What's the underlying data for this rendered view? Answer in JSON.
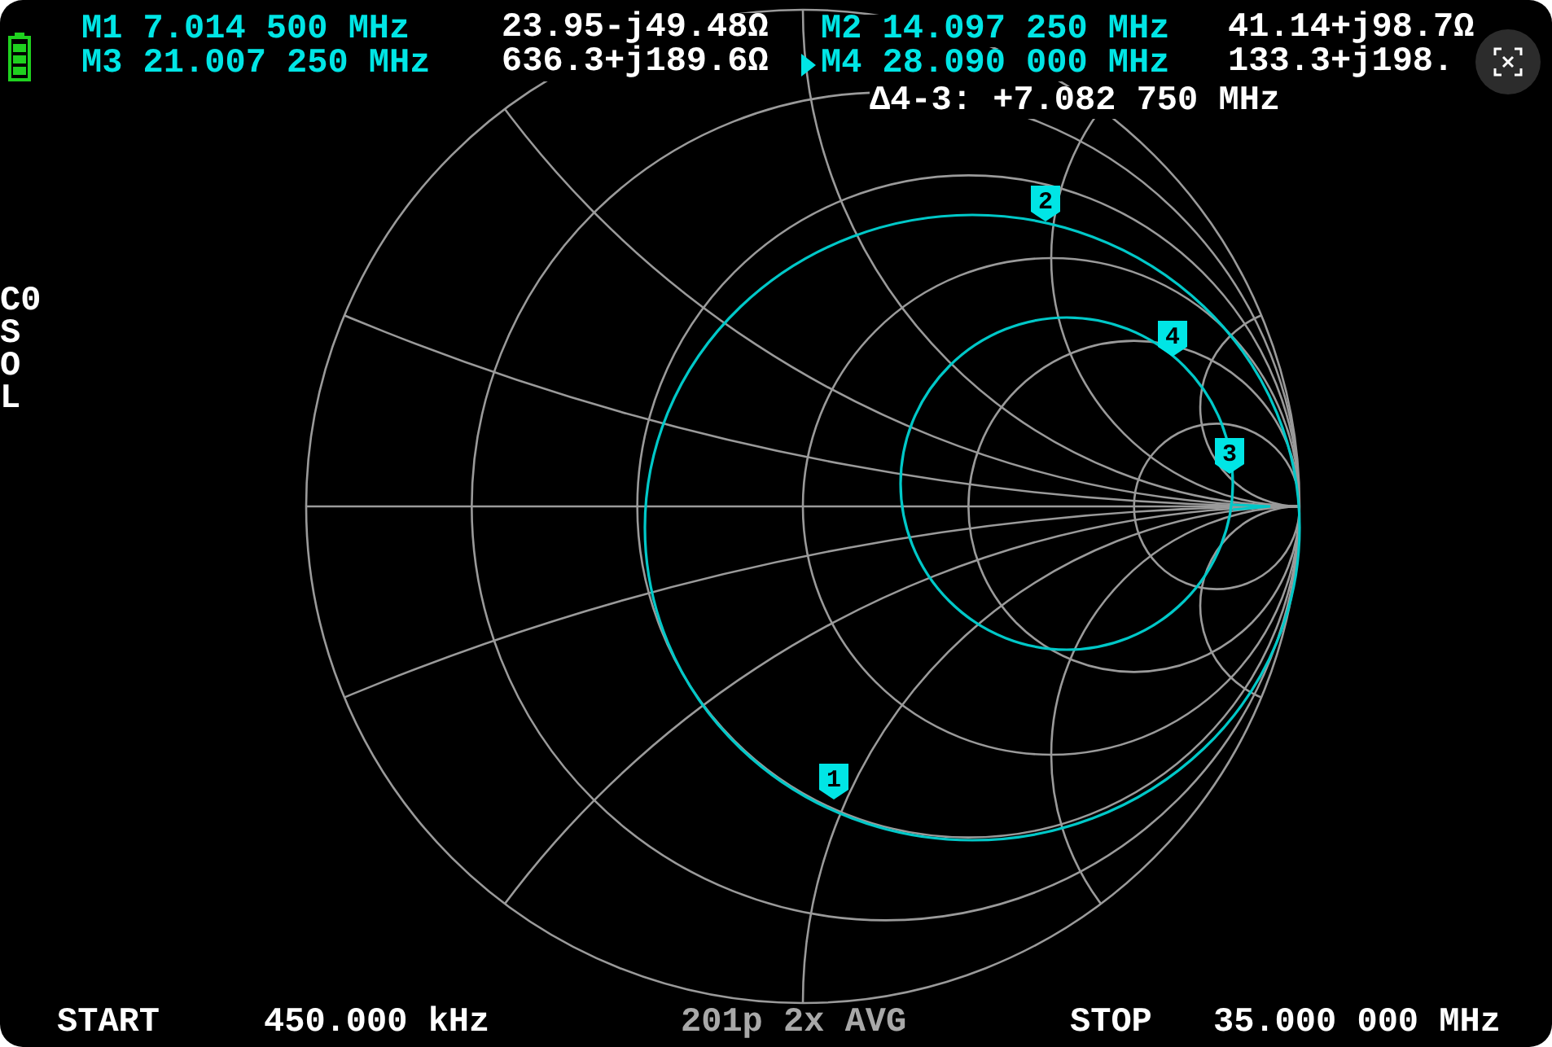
{
  "markers": [
    {
      "label": "M1",
      "frequency": "7.014 500 MHz",
      "impedance": "23.95-j49.48Ω",
      "selected": false
    },
    {
      "label": "M2",
      "frequency": "14.097 250 MHz",
      "impedance": "41.14+j98.7Ω",
      "selected": false
    },
    {
      "label": "M3",
      "frequency": "21.007 250 MHz",
      "impedance": "636.3+j189.6Ω",
      "selected": false
    },
    {
      "label": "M4",
      "frequency": "28.090 000 MHz",
      "impedance": "133.3+j198.",
      "selected": true
    }
  ],
  "delta": "Δ4-3: +7.082 750 MHz",
  "cal_status": [
    "C0",
    "S",
    "O",
    "L"
  ],
  "chart_markers": [
    "1",
    "2",
    "3",
    "4"
  ],
  "sweep": {
    "start_label": "START",
    "start": "450.000 kHz",
    "info": "201p 2x AVG",
    "stop_label": "STOP",
    "stop": "35.000 000 MHz"
  }
}
